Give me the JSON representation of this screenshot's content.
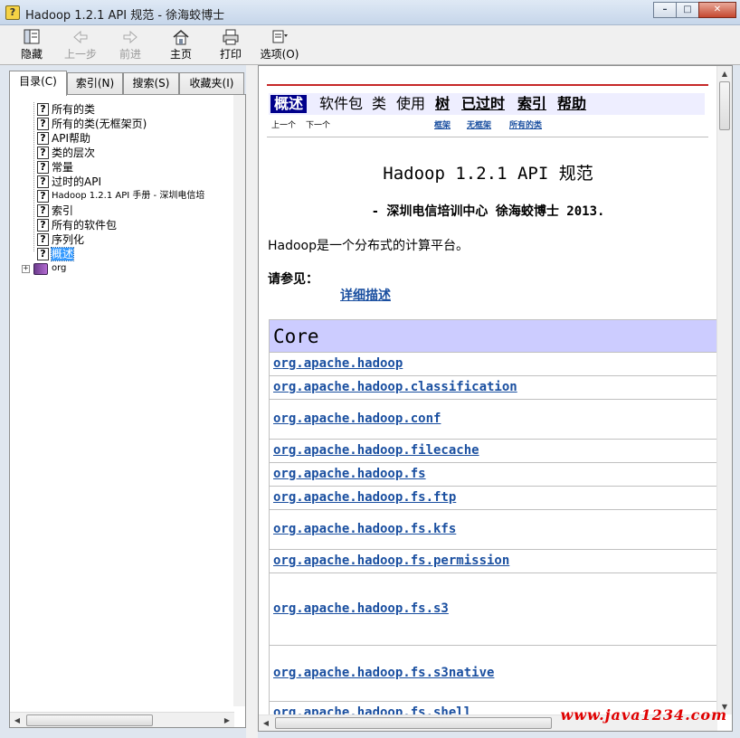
{
  "window": {
    "title": "Hadoop 1.2.1 API 规范 - 徐海蛟博士"
  },
  "toolbar": {
    "hide": "隐藏",
    "back": "上一步",
    "forward": "前进",
    "home": "主页",
    "print": "打印",
    "options": "选项(O)"
  },
  "tabs": [
    "目录(C)",
    "索引(N)",
    "搜索(S)",
    "收藏夹(I)"
  ],
  "tree": {
    "items": [
      "所有的类",
      "所有的类(无框架页)",
      "API帮助",
      "类的层次",
      "常量",
      "过时的API",
      "Hadoop 1.2.1 API 手册 - 深圳电信培",
      "索引",
      "所有的软件包",
      "序列化",
      "概述"
    ],
    "root_folder": "org"
  },
  "nav": {
    "current": "概述",
    "package": "软件包",
    "class": "类",
    "use": "使用",
    "tree": "树",
    "deprecated": "已过时",
    "index": "索引",
    "help": "帮助",
    "prev": "上一个",
    "next": "下一个",
    "frames": "框架",
    "no_frames": "无框架",
    "all_classes": "所有的类"
  },
  "doc": {
    "title": "Hadoop 1.2.1 API 规范",
    "subtitle": "- 深圳电信培训中心 徐海蛟博士 2013.",
    "description": "Hadoop是一个分布式的计算平台。",
    "see_also": "请参见：",
    "detail_link": "详细描述"
  },
  "packages": {
    "header": "Core",
    "rows": [
      "org.apache.hadoop",
      "org.apache.hadoop.classification",
      "org.apache.hadoop.conf",
      "org.apache.hadoop.filecache",
      "org.apache.hadoop.fs",
      "org.apache.hadoop.fs.ftp",
      "org.apache.hadoop.fs.kfs",
      "org.apache.hadoop.fs.permission",
      "org.apache.hadoop.fs.s3",
      "org.apache.hadoop.fs.s3native",
      "org.apache.hadoop.fs.shell"
    ]
  },
  "watermark": "www.java1234.com"
}
